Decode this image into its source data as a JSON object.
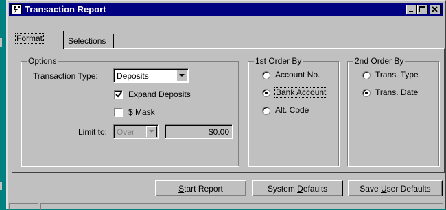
{
  "window": {
    "title": "Transaction Report"
  },
  "tabs": [
    {
      "label": "Format",
      "active": true
    },
    {
      "label": "Selections",
      "active": false
    }
  ],
  "options": {
    "legend": "Options",
    "transaction_type_label": "Transaction Type:",
    "transaction_type_value": "Deposits",
    "expand_deposits_label": "Expand Deposits",
    "expand_deposits_checked": true,
    "mask_label": "$ Mask",
    "mask_checked": false,
    "limit_label": "Limit to:",
    "limit_mode_value": "Over",
    "limit_amount": "$0.00"
  },
  "first_order": {
    "legend": "1st Order By",
    "options": [
      "Account No.",
      "Bank Account",
      "Alt. Code"
    ],
    "selected": "Bank Account"
  },
  "second_order": {
    "legend": "2nd Order By",
    "options": [
      "Trans. Type",
      "Trans. Date"
    ],
    "selected": "Trans. Date"
  },
  "buttons": {
    "start_report": {
      "pre": "",
      "accel": "S",
      "post": "tart Report"
    },
    "system_defaults": {
      "pre": "System ",
      "accel": "D",
      "post": "efaults"
    },
    "save_user_defaults": {
      "pre": "Save ",
      "accel": "U",
      "post": "ser Defaults"
    }
  },
  "colors": {
    "titlebar": "#000080",
    "face": "#c0c0c0",
    "desktop": "#008080"
  },
  "icons": [
    "app-icon",
    "minimize-icon",
    "maximize-icon",
    "close-icon",
    "dropdown-arrow-icon",
    "checkmark-icon"
  ]
}
